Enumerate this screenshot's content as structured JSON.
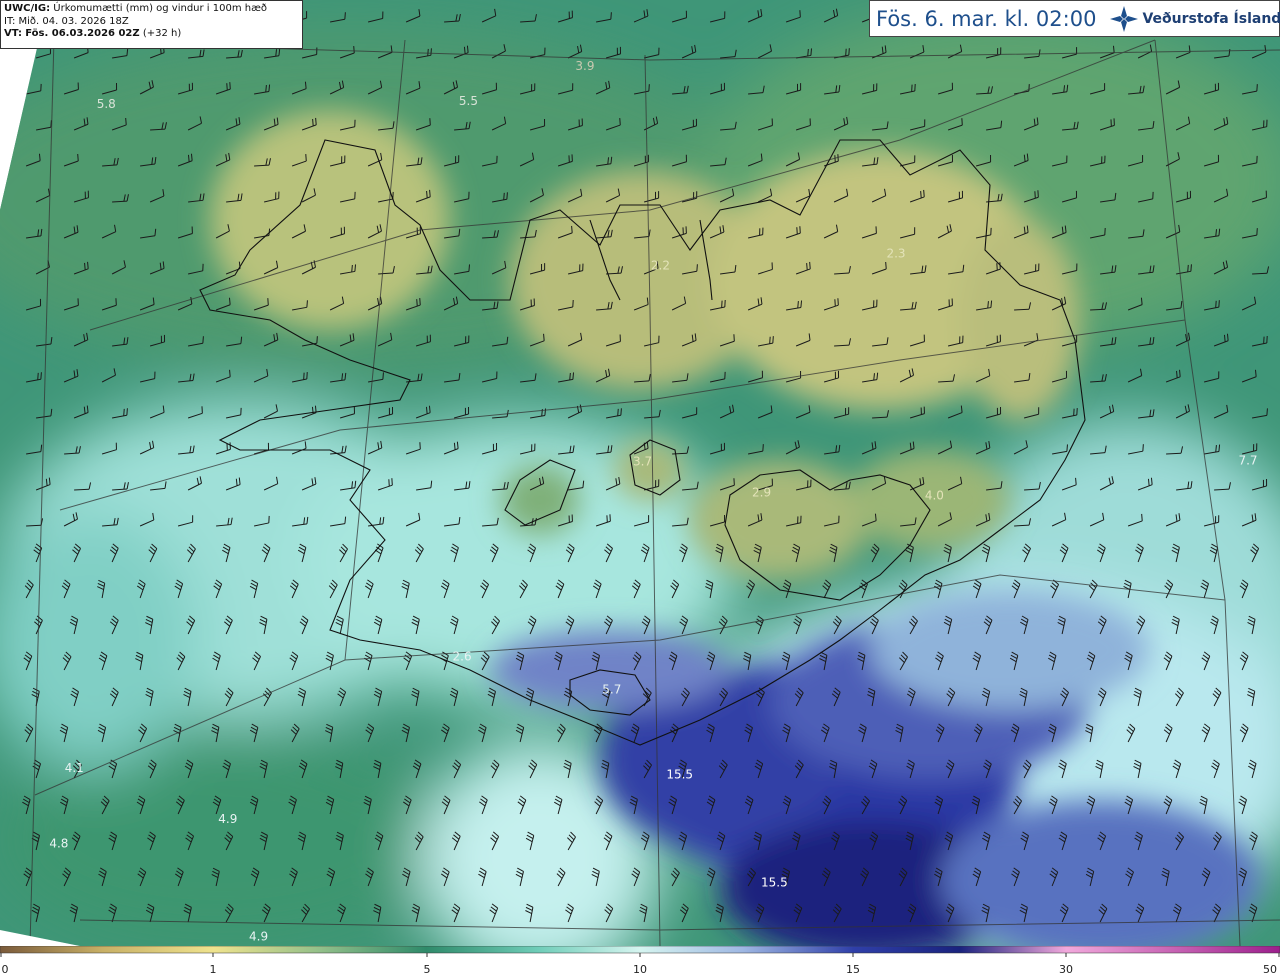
{
  "header": {
    "model": "UWC/IG:",
    "field": "Úrkomumætti (mm) og vindur i 100m hæð",
    "init_time": "IT: Mið. 04. 03. 2026 18Z",
    "valid_label": "VT:",
    "valid_time": "Fös. 06.03.2026 02Z",
    "lead": "(+32 h)"
  },
  "title_valid": "Fös. 6. mar. kl. 02:00",
  "logo": {
    "icon": "vedurstofa-logo-icon",
    "text": "Veðurstofa Íslands"
  },
  "labels": [
    {
      "text": "3.9",
      "fx": 0.457,
      "fy": 0.074,
      "c": "#c9c9b0"
    },
    {
      "text": "5.8",
      "fx": 0.083,
      "fy": 0.114,
      "c": "#d9e3d8"
    },
    {
      "text": "5.5",
      "fx": 0.366,
      "fy": 0.111,
      "c": "#d9e3d8"
    },
    {
      "text": "2.2",
      "fx": 0.516,
      "fy": 0.285,
      "c": "#e3e3b8"
    },
    {
      "text": "2.3",
      "fx": 0.7,
      "fy": 0.272,
      "c": "#e3e3b8"
    },
    {
      "text": "3.7",
      "fx": 0.502,
      "fy": 0.492,
      "c": "#e3e3b8"
    },
    {
      "text": "2.9",
      "fx": 0.595,
      "fy": 0.525,
      "c": "#e3e3b8"
    },
    {
      "text": "4.0",
      "fx": 0.73,
      "fy": 0.528,
      "c": "#e3e3b8"
    },
    {
      "text": "7.7",
      "fx": 0.975,
      "fy": 0.491,
      "c": "#e8f3f3"
    },
    {
      "text": "2.6",
      "fx": 0.361,
      "fy": 0.698,
      "c": "#e8f3f3"
    },
    {
      "text": "5.7",
      "fx": 0.478,
      "fy": 0.733,
      "c": "#e8f3f3"
    },
    {
      "text": "15.5",
      "fx": 0.531,
      "fy": 0.823,
      "c": "#ffffff"
    },
    {
      "text": "15.5",
      "fx": 0.605,
      "fy": 0.937,
      "c": "#ffffff"
    },
    {
      "text": "4.1",
      "fx": 0.058,
      "fy": 0.816,
      "c": "#e8f3f3"
    },
    {
      "text": "4.9",
      "fx": 0.178,
      "fy": 0.87,
      "c": "#e8f3f3"
    },
    {
      "text": "4.8",
      "fx": 0.046,
      "fy": 0.896,
      "c": "#e8f3f3"
    },
    {
      "text": "4.9",
      "fx": 0.202,
      "fy": 0.994,
      "c": "#e8f3f3"
    }
  ],
  "colorbar": {
    "ticks": [
      "0",
      "1",
      "5",
      "10",
      "15",
      "30",
      "50"
    ],
    "units": "mm"
  },
  "colors": {
    "sea_green": "#2f8a6a",
    "land_yellow": "#c8c888",
    "light_cyan": "#bfeee8",
    "deep_blue": "#1e2a8c"
  }
}
